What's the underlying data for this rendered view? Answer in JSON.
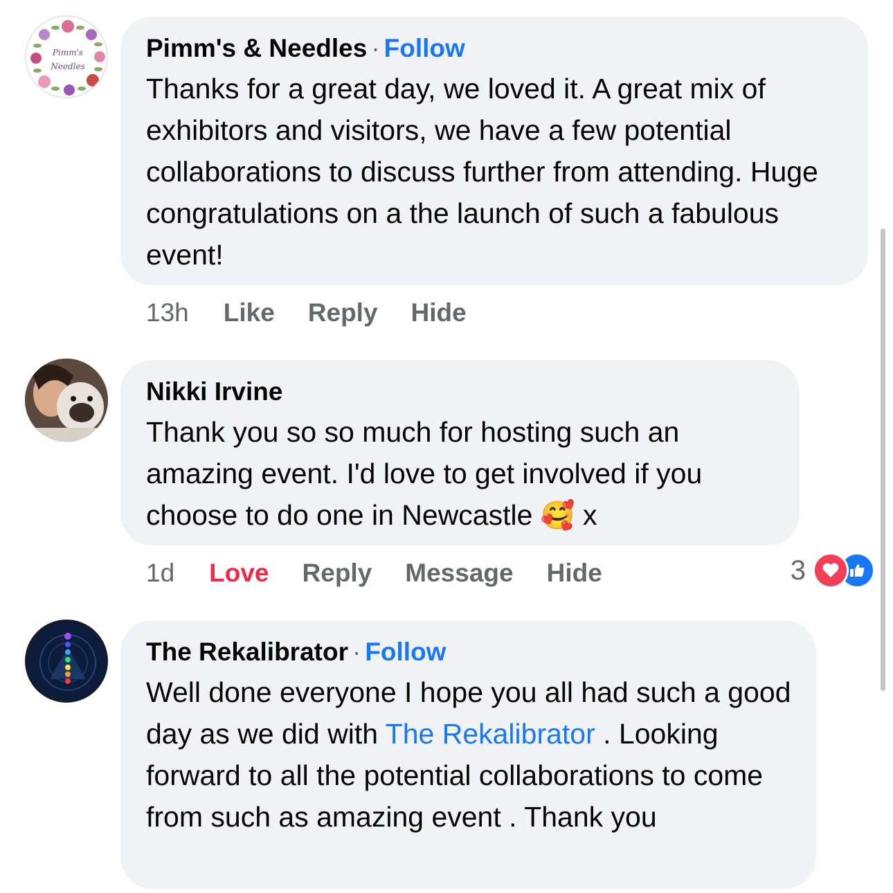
{
  "comments": [
    {
      "author": "Pimm's & Needles",
      "separator": "·",
      "follow_label": "Follow",
      "avatar_text": "Pimm's and Needles",
      "text": "Thanks for a great day, we loved it. A great mix of exhibitors and visitors, we have a few potential collaborations to discuss further from attending. Huge congratulations on a the launch of such a fabulous event!",
      "time": "13h",
      "actions": [
        "Like",
        "Reply",
        "Hide"
      ]
    },
    {
      "author": "Nikki Irvine",
      "text_before_emoji": "Thank you so so much for hosting such an amazing event. I'd love to get involved if you choose to do one in Newcastle",
      "emoji": "🥰",
      "text_after_emoji": "x",
      "time": "1d",
      "actions": [
        "Love",
        "Reply",
        "Message",
        "Hide"
      ],
      "reaction_count": "3",
      "reaction_icons": [
        "heart-icon",
        "like-icon"
      ]
    },
    {
      "author": "The Rekalibrator",
      "separator": "·",
      "follow_label": "Follow",
      "text_part1": "Well done everyone I hope you all had such a good day as we did with",
      "mention": "The Rekalibrator",
      "text_part2": ". Looking forward to all the potential collaborations to come from such as amazing event . Thank you"
    }
  ],
  "colors": {
    "bubble": "#f0f2f5",
    "link": "#1877f2",
    "love": "#f02849",
    "secondary_text": "#65676b"
  }
}
